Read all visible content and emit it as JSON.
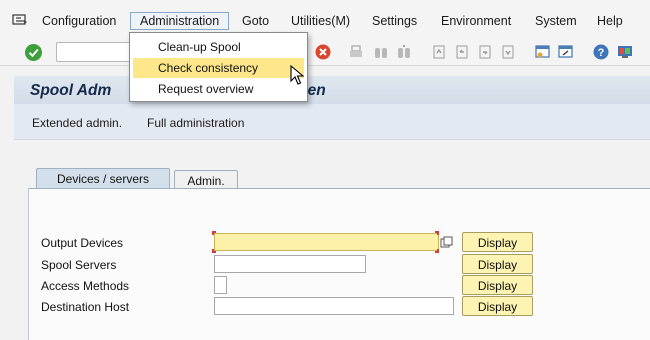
{
  "menubar": {
    "items": [
      {
        "label": "Configuration"
      },
      {
        "label": "Administration"
      },
      {
        "label": "Goto"
      },
      {
        "label": "Utilities(M)"
      },
      {
        "label": "Settings"
      },
      {
        "label": "Environment"
      },
      {
        "label": "System"
      },
      {
        "label": "Help"
      }
    ]
  },
  "toolbar": {
    "command_field_value": "",
    "icons": [
      "enter-icon",
      "cancel-icon",
      "print-icon",
      "find-icon",
      "find-next-icon",
      "first-page-icon",
      "previous-page-icon",
      "next-page-icon",
      "last-page-icon",
      "create-session-icon",
      "shortcut-icon",
      "help-icon",
      "customize-layout-icon"
    ]
  },
  "title": {
    "visible_left": "Spool Adm",
    "visible_right": "reen"
  },
  "application_toolbar": {
    "items": [
      "Extended admin.",
      "Full administration"
    ]
  },
  "tabs": {
    "active": "Devices / servers",
    "inactive": "Admin."
  },
  "fields": [
    {
      "label": "Output Devices",
      "value": "",
      "button": "Display"
    },
    {
      "label": "Spool Servers",
      "value": "",
      "button": "Display"
    },
    {
      "label": "Access Methods",
      "value": "",
      "button": "Display"
    },
    {
      "label": "Destination Host",
      "value": "",
      "button": "Display"
    }
  ],
  "dropdown": {
    "items": [
      {
        "label": "Clean-up Spool"
      },
      {
        "label": "Check consistency",
        "highlighted": true
      },
      {
        "label": "Request overview"
      }
    ]
  },
  "colors": {
    "title_text": "#16294a",
    "title_bar": "#d3dde9",
    "highlight": "#fde78a",
    "required_input": "#fdf0a8",
    "button_bg": "#fdf3b2"
  }
}
